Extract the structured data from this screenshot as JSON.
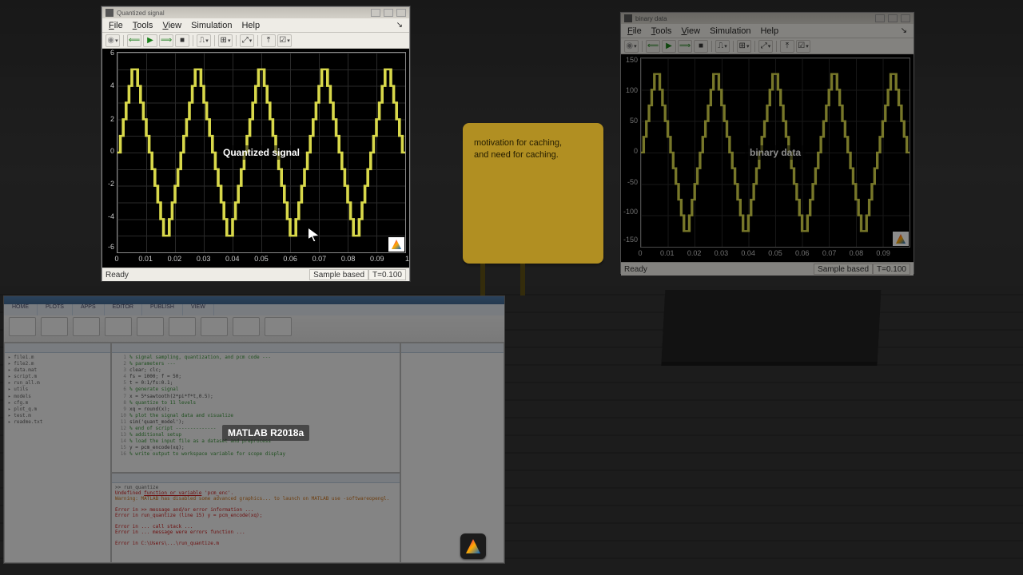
{
  "sticky": {
    "line1": "motivation for caching,",
    "line2": "and need for caching."
  },
  "matlab_badge": "MATLAB R2018a",
  "scope1": {
    "title": "Quantized signal",
    "menus": {
      "file": "File",
      "tools": "Tools",
      "view": "View",
      "simulation": "Simulation",
      "help": "Help"
    },
    "overlay_label": "Quantized signal",
    "status_ready": "Ready",
    "status_mode": "Sample based",
    "status_time": "T=0.100",
    "extra_one": "1",
    "y_ticks": [
      "6",
      "4",
      "2",
      "0",
      "-2",
      "-4",
      "-6"
    ],
    "x_ticks": [
      "0",
      "0.01",
      "0.02",
      "0.03",
      "0.04",
      "0.05",
      "0.06",
      "0.07",
      "0.08",
      "0.09"
    ]
  },
  "scope2": {
    "title": "binary data",
    "menus": {
      "file": "File",
      "tools": "Tools",
      "view": "View",
      "simulation": "Simulation",
      "help": "Help"
    },
    "overlay_label": "binary data",
    "status_ready": "Ready",
    "status_mode": "Sample based",
    "status_time": "T=0.100",
    "y_ticks": [
      "150",
      "100",
      "50",
      "0",
      "-50",
      "-100",
      "-150"
    ],
    "x_ticks": [
      "0",
      "0.01",
      "0.02",
      "0.03",
      "0.04",
      "0.05",
      "0.06",
      "0.07",
      "0.08",
      "0.09"
    ]
  },
  "chart_data": [
    {
      "id": "quantized_signal",
      "type": "line",
      "title": "Quantized signal",
      "xlabel": "",
      "ylabel": "",
      "xlim": [
        0,
        0.1
      ],
      "ylim": [
        -6,
        6
      ],
      "x_step": 0.001,
      "note": "Stair-step quantized triangular waveform, 5 periods over 0–0.1s, integer levels −5…5",
      "series": [
        {
          "name": "quantized",
          "y": [
            0,
            1,
            2,
            3,
            4,
            5,
            5,
            4,
            3,
            2,
            1,
            0,
            -1,
            -2,
            -3,
            -4,
            -5,
            -5,
            -4,
            -3,
            -2,
            -1,
            0,
            1,
            2,
            3,
            4,
            5,
            5,
            4,
            3,
            2,
            1,
            0,
            -1,
            -2,
            -3,
            -4,
            -5,
            -5,
            -4,
            -3,
            -2,
            -1,
            0,
            1,
            2,
            3,
            4,
            5,
            5,
            4,
            3,
            2,
            1,
            0,
            -1,
            -2,
            -3,
            -4,
            -5,
            -5,
            -4,
            -3,
            -2,
            -1,
            0,
            1,
            2,
            3,
            4,
            5,
            5,
            4,
            3,
            2,
            1,
            0,
            -1,
            -2,
            -3,
            -4,
            -5,
            -5,
            -4,
            -3,
            -2,
            -1,
            0,
            1,
            2,
            3,
            4,
            5,
            5,
            4,
            3,
            2,
            1,
            0
          ]
        }
      ]
    },
    {
      "id": "binary_data",
      "type": "line",
      "title": "binary data",
      "xlabel": "",
      "ylabel": "",
      "xlim": [
        0,
        0.1
      ],
      "ylim": [
        -150,
        150
      ],
      "x_step": 0.001,
      "note": "Encoded stair-step waveform, same period as quantized signal, levels approx −125…125 in steps of 25",
      "series": [
        {
          "name": "binary",
          "y": [
            0,
            25,
            50,
            75,
            100,
            125,
            125,
            100,
            75,
            50,
            25,
            0,
            -25,
            -50,
            -75,
            -100,
            -125,
            -125,
            -100,
            -75,
            -50,
            -25,
            0,
            25,
            50,
            75,
            100,
            125,
            125,
            100,
            75,
            50,
            25,
            0,
            -25,
            -50,
            -75,
            -100,
            -125,
            -125,
            -100,
            -75,
            -50,
            -25,
            0,
            25,
            50,
            75,
            100,
            125,
            125,
            100,
            75,
            50,
            25,
            0,
            -25,
            -50,
            -75,
            -100,
            -125,
            -125,
            -100,
            -75,
            -50,
            -25,
            0,
            25,
            50,
            75,
            100,
            125,
            125,
            100,
            75,
            50,
            25,
            0,
            -25,
            -50,
            -75,
            -100,
            -125,
            -125,
            -100,
            -75,
            -50,
            -25,
            0,
            25,
            50,
            75,
            100,
            125,
            125,
            100,
            75,
            50,
            25,
            0
          ]
        }
      ]
    }
  ]
}
